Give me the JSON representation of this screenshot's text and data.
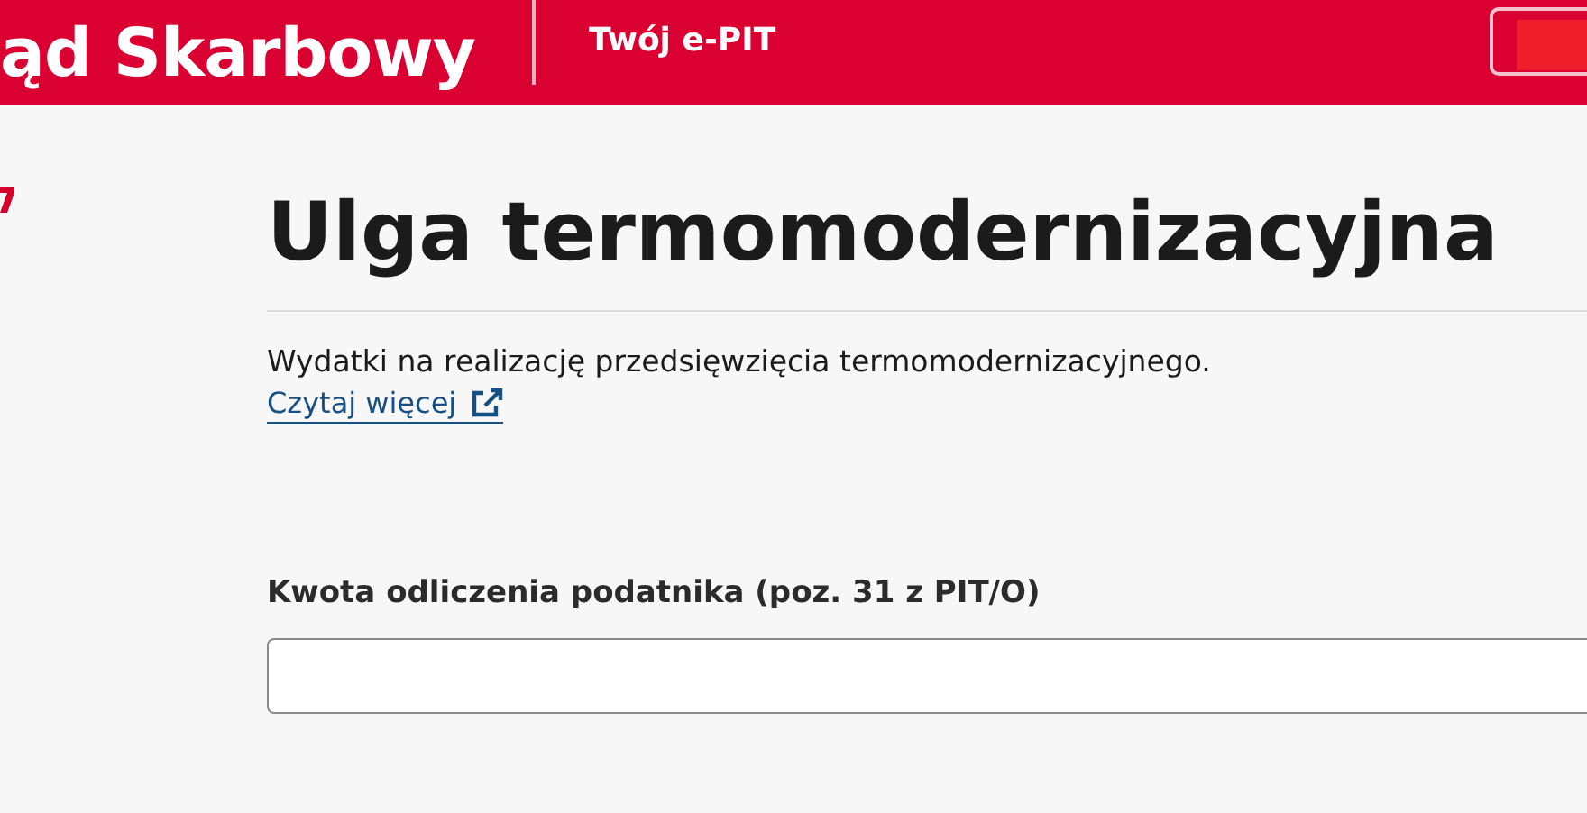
{
  "header": {
    "brand": "ąd Skarbowy",
    "service": "Twój e-PIT"
  },
  "title": "Ulga termomodernizacyjna",
  "description": "Wydatki na realizację przedsięwzięcia termomodernizacyjnego.",
  "link": "Czytaj więcej",
  "field": {
    "label": "Kwota odliczenia podatnika (poz. 31 z PIT/O)"
  }
}
